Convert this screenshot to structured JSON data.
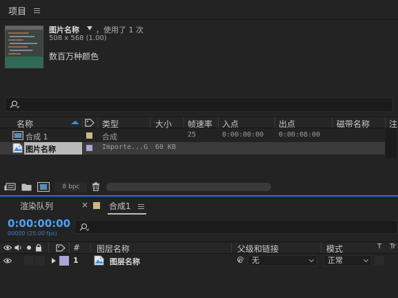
{
  "project_panel": {
    "tab_label": "项目",
    "asset": {
      "name": "图片名称",
      "usage": "，使用了 1 次",
      "dimensions": "508 x 568 (1.00)",
      "color_info": "数百万种颜色"
    },
    "columns": [
      "名称",
      "类型",
      "大小",
      "帧速率",
      "入点",
      "出点",
      "磁带名称",
      "注"
    ],
    "rows": [
      {
        "name": "合成 1",
        "type": "合成",
        "size": "",
        "fps": "25",
        "in": "0:00:00:00",
        "out": "0:00:08:00",
        "label_color": "#cbb784"
      },
      {
        "name": "图片名称",
        "type": "Importe...G",
        "size": "60 KB",
        "fps": "",
        "in": "",
        "out": "",
        "label_color": "#a9a5d4"
      }
    ],
    "bpc": "8 bpc"
  },
  "timeline_panel": {
    "render_queue_tab": "渲染队列",
    "close_symbol": "×",
    "comp_tab": "合成1",
    "timecode": "0:00:00:00",
    "frames": "00000 (25.00 fps)",
    "columns": {
      "number": "#",
      "layer_name": "图层名称",
      "parent": "父级和链接",
      "mode": "模式",
      "t": "T",
      "trkmat": "Tr"
    },
    "layer": {
      "index": "1",
      "name": "图层名称",
      "parent_value": "无",
      "mode_value": "正常"
    }
  },
  "colors": {
    "accent": "#4aa3ff",
    "divider": "#2b6fd1",
    "comp_label": "#cbb784",
    "footage_label": "#a9a5d4"
  }
}
